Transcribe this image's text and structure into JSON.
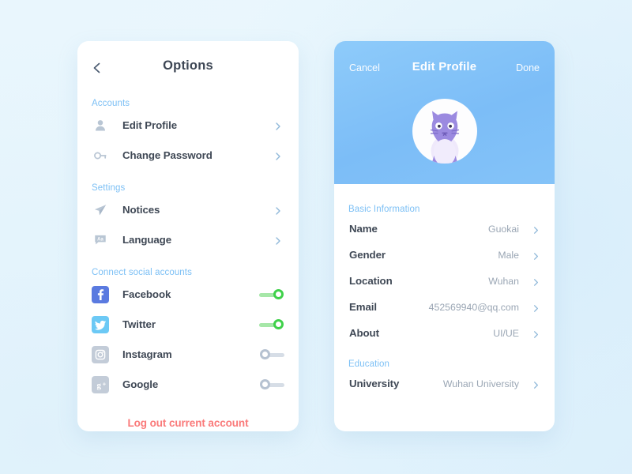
{
  "colors": {
    "accent_blue": "#7dc0f5",
    "hero_blue": "#84c3f8",
    "toggle_on": "#3fd14a",
    "toggle_off": "#b6c2d1",
    "logout_red": "#fa7a7a",
    "text_dark": "#3f4855",
    "text_muted": "#9aa6b4",
    "card_white": "#ffffff",
    "avatar_purple": "#9b8ae0"
  },
  "options_panel": {
    "back_icon": "chevron-left-icon",
    "title": "Options",
    "sections": [
      {
        "label": "Accounts",
        "items": [
          {
            "icon": "person-icon",
            "label": "Edit Profile",
            "chevron": "chevron-right-icon"
          },
          {
            "icon": "key-icon",
            "label": "Change Password",
            "chevron": "chevron-right-icon"
          }
        ]
      },
      {
        "label": "Settings",
        "items": [
          {
            "icon": "paper-plane-icon",
            "label": "Notices",
            "chevron": "chevron-right-icon"
          },
          {
            "icon": "language-bubble-icon",
            "label": "Language",
            "chevron": "chevron-right-icon"
          }
        ]
      }
    ],
    "social_section": {
      "label": "Connect social accounts",
      "items": [
        {
          "icon": "facebook-icon",
          "glyph": "f",
          "label": "Facebook",
          "state": "on"
        },
        {
          "icon": "twitter-icon",
          "glyph": "t",
          "label": "Twitter",
          "state": "on"
        },
        {
          "icon": "instagram-icon",
          "glyph": "i",
          "label": "Instagram",
          "state": "off"
        },
        {
          "icon": "google-plus-icon",
          "glyph": "g+",
          "label": "Google",
          "state": "off"
        }
      ]
    },
    "logout_label": "Log out current account"
  },
  "profile_panel": {
    "cancel_label": "Cancel",
    "title": "Edit Profile",
    "done_label": "Done",
    "avatar_icon": "cat-avatar-icon",
    "basic_section": {
      "label": "Basic Information",
      "fields": [
        {
          "label": "Name",
          "value": "Guokai"
        },
        {
          "label": "Gender",
          "value": "Male"
        },
        {
          "label": "Location",
          "value": "Wuhan"
        },
        {
          "label": "Email",
          "value": "452569940@qq.com"
        },
        {
          "label": "About",
          "value": "UI/UE"
        }
      ]
    },
    "education_section": {
      "label": "Education",
      "fields": [
        {
          "label": "University",
          "value": "Wuhan University"
        }
      ]
    }
  }
}
